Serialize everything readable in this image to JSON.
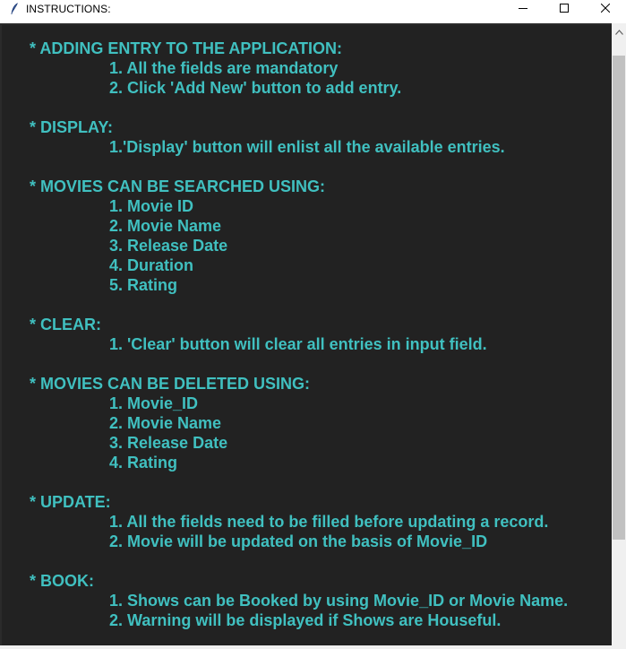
{
  "window": {
    "title": "INSTRUCTIONS:",
    "icon": "feather-icon",
    "controls": [
      "minimize-icon",
      "maximize-icon",
      "close-icon"
    ]
  },
  "colors": {
    "background": "#222222",
    "text": "#40c0c0"
  },
  "instructions": {
    "sections": [
      {
        "heading": "* ADDING ENTRY TO THE APPLICATION:",
        "items": [
          "1. All the fields are mandatory",
          "2. Click 'Add New' button to add entry."
        ]
      },
      {
        "heading": "* DISPLAY:",
        "items": [
          "1.'Display' button will enlist all the available entries."
        ]
      },
      {
        "heading": "* MOVIES CAN BE SEARCHED USING:",
        "items": [
          "1. Movie ID",
          "2. Movie Name",
          "3. Release Date",
          "4. Duration",
          "5. Rating"
        ]
      },
      {
        "heading": "* CLEAR:",
        "items": [
          "1. 'Clear' button will clear all entries in input field."
        ]
      },
      {
        "heading": "* MOVIES CAN BE DELETED USING:",
        "items": [
          "1. Movie_ID",
          "2. Movie Name",
          "3. Release Date",
          "4. Rating"
        ]
      },
      {
        "heading": "* UPDATE:",
        "items": [
          "1. All the fields need to be filled before updating a record.",
          "2. Movie will be updated on the basis of Movie_ID"
        ]
      },
      {
        "heading": "* BOOK:",
        "items": [
          "1. Shows can be Booked by using Movie_ID or Movie Name.",
          "2. Warning will be displayed if Shows are Houseful."
        ]
      }
    ]
  }
}
